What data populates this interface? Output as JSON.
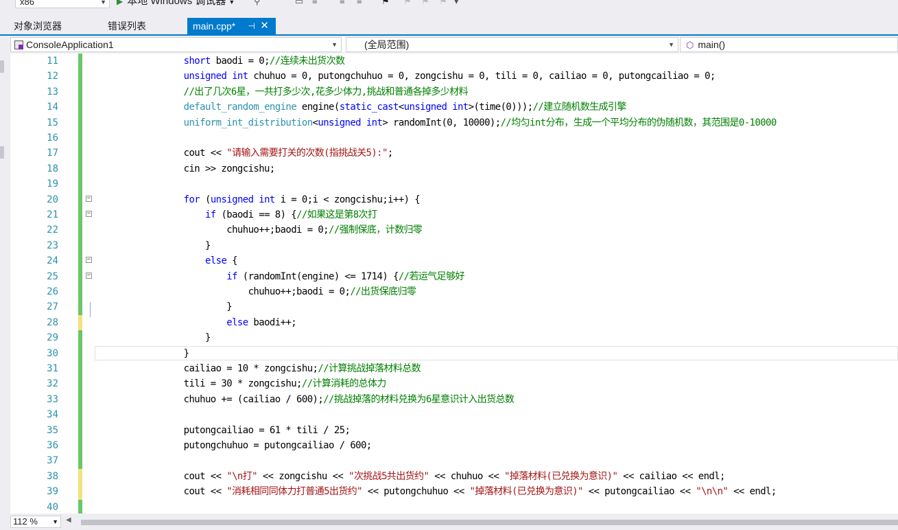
{
  "toolbar": {
    "platform": "x86",
    "debugger_label": "本地 Windows 调试器"
  },
  "tabs": [
    {
      "label": "对象浏览器"
    },
    {
      "label": "错误列表"
    },
    {
      "label": "main.cpp*",
      "active": true
    }
  ],
  "navbar": {
    "project": "ConsoleApplication1",
    "scope": "(全局范围)",
    "member": "main()"
  },
  "editor": {
    "lines": [
      {
        "n": "11",
        "change": "green",
        "fold": "",
        "tokens": [
          [
            "",
            "        "
          ],
          [
            "k",
            "short"
          ],
          [
            "",
            " baodi = 0;"
          ],
          [
            "cm",
            "//连续未出货次数"
          ]
        ]
      },
      {
        "n": "12",
        "change": "green",
        "fold": "",
        "tokens": [
          [
            "",
            "        "
          ],
          [
            "k",
            "unsigned int"
          ],
          [
            "",
            " chuhuo = 0, putongchuhuo = 0, zongcishu = 0, tili = 0, cailiao = 0, putongcailiao = 0;"
          ]
        ]
      },
      {
        "n": "13",
        "change": "green",
        "fold": "",
        "tokens": [
          [
            "",
            "        "
          ],
          [
            "cm",
            "//出了几次6星，一共打多少次,花多少体力,挑战和普通各掉多少材料"
          ]
        ]
      },
      {
        "n": "14",
        "change": "green",
        "fold": "",
        "tokens": [
          [
            "",
            "        "
          ],
          [
            "t",
            "default_random_engine"
          ],
          [
            "",
            " engine("
          ],
          [
            "k",
            "static_cast"
          ],
          [
            "",
            "<"
          ],
          [
            "k",
            "unsigned int"
          ],
          [
            "",
            ">(time(0)));"
          ],
          [
            "cm",
            "//建立随机数生成引擎"
          ]
        ]
      },
      {
        "n": "15",
        "change": "green",
        "fold": "",
        "tokens": [
          [
            "",
            "        "
          ],
          [
            "t",
            "uniform_int_distribution"
          ],
          [
            "",
            "<"
          ],
          [
            "k",
            "unsigned int"
          ],
          [
            "",
            "> randomInt(0, 10000);"
          ],
          [
            "cm",
            "//均匀int分布，生成一个平均分布的伪随机数，其范围是0-10000"
          ]
        ]
      },
      {
        "n": "16",
        "change": "green",
        "fold": "",
        "tokens": [
          [
            "",
            ""
          ]
        ]
      },
      {
        "n": "17",
        "change": "green",
        "fold": "",
        "tokens": [
          [
            "",
            "        cout << "
          ],
          [
            "s",
            "\"请输入需要打关的次数(指挑战关5):\""
          ],
          [
            "",
            ";"
          ]
        ]
      },
      {
        "n": "18",
        "change": "green",
        "fold": "",
        "tokens": [
          [
            "",
            "        cin >> zongcishu;"
          ]
        ]
      },
      {
        "n": "19",
        "change": "green",
        "fold": "",
        "tokens": [
          [
            "",
            ""
          ]
        ]
      },
      {
        "n": "20",
        "change": "green",
        "fold": "minus",
        "tokens": [
          [
            "",
            "        "
          ],
          [
            "k",
            "for"
          ],
          [
            "",
            " ("
          ],
          [
            "k",
            "unsigned int"
          ],
          [
            "",
            " i = 0;i < zongcishu;i++) {"
          ]
        ]
      },
      {
        "n": "21",
        "change": "green",
        "fold": "minus",
        "tokens": [
          [
            "",
            "            "
          ],
          [
            "k",
            "if"
          ],
          [
            "",
            " (baodi == 8) {"
          ],
          [
            "cm",
            "//如果这是第8次打"
          ]
        ]
      },
      {
        "n": "22",
        "change": "green",
        "fold": "",
        "tokens": [
          [
            "",
            "                chuhuo++;baodi = 0;"
          ],
          [
            "cm",
            "//强制保底，计数归零"
          ]
        ]
      },
      {
        "n": "23",
        "change": "green",
        "fold": "",
        "tokens": [
          [
            "",
            "            }"
          ]
        ]
      },
      {
        "n": "24",
        "change": "green",
        "fold": "minus",
        "tokens": [
          [
            "",
            "            "
          ],
          [
            "k",
            "else"
          ],
          [
            "",
            " {"
          ]
        ]
      },
      {
        "n": "25",
        "change": "green",
        "fold": "minus",
        "tokens": [
          [
            "",
            "                "
          ],
          [
            "k",
            "if"
          ],
          [
            "",
            " (randomInt(engine) <= 1714) {"
          ],
          [
            "cm",
            "//若运气足够好"
          ]
        ]
      },
      {
        "n": "26",
        "change": "green",
        "fold": "",
        "tokens": [
          [
            "",
            "                    chuhuo++;baodi = 0;"
          ],
          [
            "cm",
            "//出货保底归零"
          ]
        ]
      },
      {
        "n": "27",
        "change": "green",
        "fold": "",
        "tokens": [
          [
            "",
            "                }"
          ]
        ]
      },
      {
        "n": "28",
        "change": "yellow",
        "fold": "",
        "tokens": [
          [
            "",
            "                "
          ],
          [
            "k",
            "else"
          ],
          [
            "",
            " baodi++;"
          ]
        ]
      },
      {
        "n": "29",
        "change": "green",
        "fold": "",
        "tokens": [
          [
            "",
            "            }"
          ]
        ]
      },
      {
        "n": "30",
        "change": "green",
        "fold": "",
        "tokens": [
          [
            "",
            "        }"
          ]
        ]
      },
      {
        "n": "31",
        "change": "green",
        "fold": "",
        "tokens": [
          [
            "",
            "        cailiao = 10 * zongcishu;"
          ],
          [
            "cm",
            "//计算挑战掉落材料总数"
          ]
        ]
      },
      {
        "n": "32",
        "change": "green",
        "fold": "",
        "tokens": [
          [
            "",
            "        tili = 30 * zongcishu;"
          ],
          [
            "cm",
            "//计算消耗的总体力"
          ]
        ]
      },
      {
        "n": "33",
        "change": "green",
        "fold": "",
        "tokens": [
          [
            "",
            "        chuhuo += (cailiao / 600);"
          ],
          [
            "cm",
            "//挑战掉落的材料兑换为6星意识计入出货总数"
          ]
        ]
      },
      {
        "n": "34",
        "change": "green",
        "fold": "",
        "tokens": [
          [
            "",
            ""
          ]
        ]
      },
      {
        "n": "35",
        "change": "green",
        "fold": "",
        "tokens": [
          [
            "",
            "        putongcailiao = 61 * tili / 25;"
          ]
        ]
      },
      {
        "n": "36",
        "change": "green",
        "fold": "",
        "tokens": [
          [
            "",
            "        putongchuhuo = putongcailiao / 600;"
          ]
        ]
      },
      {
        "n": "37",
        "change": "green",
        "fold": "",
        "tokens": [
          [
            "",
            ""
          ]
        ]
      },
      {
        "n": "38",
        "change": "yellow",
        "fold": "",
        "tokens": [
          [
            "",
            "        cout << "
          ],
          [
            "s",
            "\"\\n打\""
          ],
          [
            "",
            " << zongcishu << "
          ],
          [
            "s",
            "\"次挑战5共出货约\""
          ],
          [
            "",
            " << chuhuo << "
          ],
          [
            "s",
            "\"掉落材料(已兑换为意识)\""
          ],
          [
            "",
            " << cailiao << endl;"
          ]
        ]
      },
      {
        "n": "39",
        "change": "yellow",
        "fold": "",
        "tokens": [
          [
            "",
            "        cout << "
          ],
          [
            "s",
            "\"消耗相同同体力打普通5出货约\""
          ],
          [
            "",
            " << putongchuhuo << "
          ],
          [
            "s",
            "\"掉落材料(已兑换为意识)\""
          ],
          [
            "",
            " << putongcailiao << "
          ],
          [
            "s",
            "\"\\n\\n\""
          ],
          [
            "",
            " << endl;"
          ]
        ]
      },
      {
        "n": "40",
        "change": "green",
        "fold": "",
        "tokens": [
          [
            "",
            ""
          ]
        ]
      }
    ]
  },
  "statusbar": {
    "zoom": "112 %"
  },
  "colors": {
    "accent": "#007acc",
    "change_green": "#6cc66c",
    "change_yellow": "#f3e27a"
  }
}
